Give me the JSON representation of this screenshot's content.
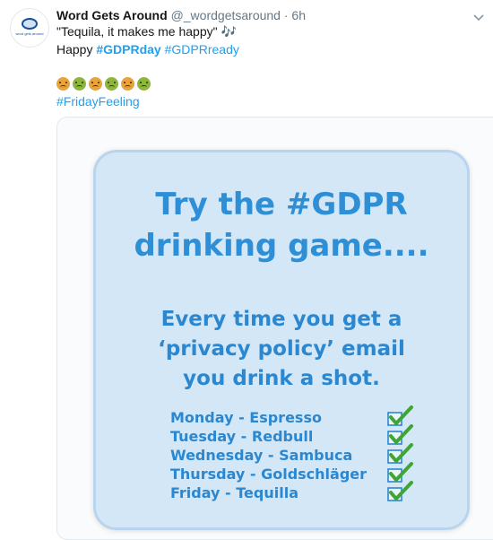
{
  "tweet": {
    "name": "Word Gets Around",
    "handle": "@_wordgetsaround",
    "separator": "·",
    "time": "6h",
    "avatar_text": "word gets around",
    "line1": "\"Tequila, it makes me happy\" 🎶",
    "line2_prefix": "Happy ",
    "hashtag1": "#GDPRday",
    "hashtag2": "#GDPRready",
    "emoji_icons": [
      "nauseated-face-icon",
      "nauseated-face-icon",
      "nauseated-face-icon",
      "nauseated-face-icon",
      "nauseated-face-icon",
      "nauseated-face-icon"
    ],
    "hashtag3": "#FridayFeeling"
  },
  "image": {
    "title_line1": "Try the #GDPR",
    "title_line2": "drinking game....",
    "subtitle_line1": "Every time you get a",
    "subtitle_line2": "‘privacy policy’ email",
    "subtitle_line3": "you drink a shot.",
    "days": [
      "Monday - Espresso",
      "Tuesday - Redbull",
      "Wednesday - Sambuca",
      "Thursday - Goldschläger",
      "Friday - Tequilla"
    ],
    "colors": {
      "panel_bg": "#d3e7f7",
      "text_blue": "#2b87cf",
      "check_green": "#3fa535"
    }
  }
}
